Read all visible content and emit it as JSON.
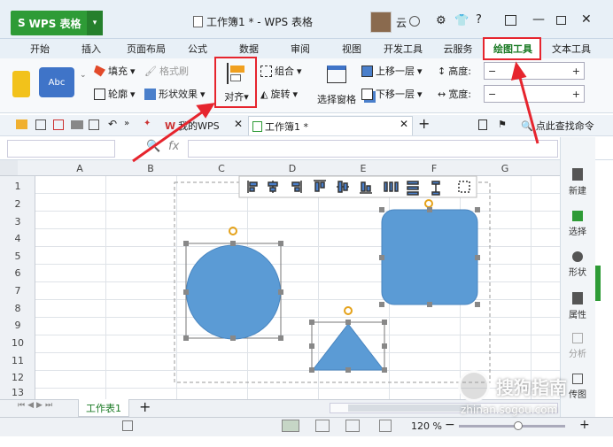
{
  "app": {
    "logo": "WPS 表格",
    "logo_glyph": "S",
    "title": "工作簿1 * - WPS 表格",
    "user": "云"
  },
  "tabs": [
    {
      "label": "开始"
    },
    {
      "label": "插入"
    },
    {
      "label": "页面布局"
    },
    {
      "label": "公式"
    },
    {
      "label": "数据"
    },
    {
      "label": "审阅"
    },
    {
      "label": "视图"
    },
    {
      "label": "开发工具"
    },
    {
      "label": "云服务"
    },
    {
      "label": "绘图工具"
    },
    {
      "label": "文本工具"
    }
  ],
  "ribbon": {
    "style_abc": "Abc",
    "fill": "填充",
    "format_brush": "格式刷",
    "outline": "轮廓",
    "shape_effect": "形状效果",
    "align": "对齐",
    "group": "组合",
    "rotate": "旋转",
    "select_pane": "选择窗格",
    "bring_forward": "上移一层",
    "send_backward": "下移一层",
    "height": "高度:",
    "width": "宽度:",
    "minus": "−",
    "plus": "+"
  },
  "quick": {
    "doc_tab1": "我的WPS",
    "doc_tab2": "工作簿1 *",
    "search": "点此查找命令"
  },
  "formula": {
    "fx": "fx"
  },
  "columns": [
    "A",
    "B",
    "C",
    "D",
    "E",
    "F",
    "G"
  ],
  "rows": [
    "1",
    "2",
    "3",
    "4",
    "5",
    "6",
    "7",
    "8",
    "9",
    "10",
    "11",
    "12",
    "13"
  ],
  "right_panel": [
    {
      "label": "新建"
    },
    {
      "label": "选择"
    },
    {
      "label": "形状"
    },
    {
      "label": "属性"
    },
    {
      "label": "分析"
    },
    {
      "label": "传图"
    }
  ],
  "sheet": {
    "name": "工作表1",
    "add": "+"
  },
  "status": {
    "zoom": "120 %"
  },
  "watermark": {
    "brand": "搜狗指南",
    "url": "zhinan.sogou.com"
  },
  "colors": {
    "accent": "#2e9b36",
    "shape": "#5b9bd5",
    "highlight": "#e6252e"
  }
}
